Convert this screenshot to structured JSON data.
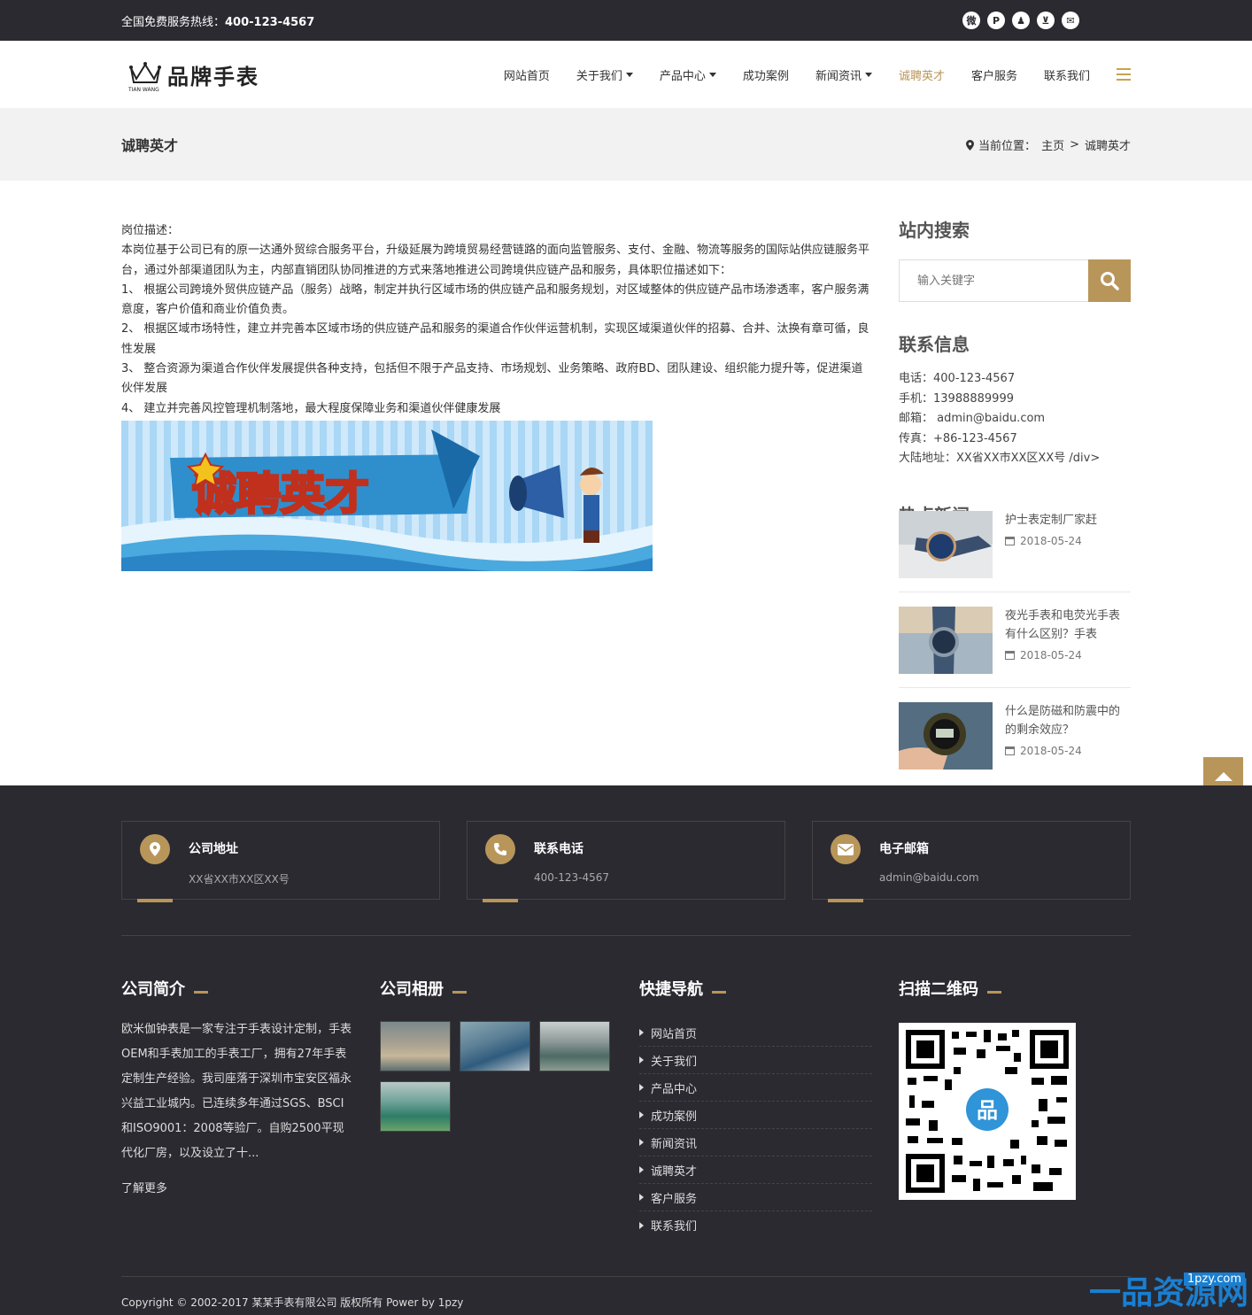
{
  "topbar": {
    "hotline_label": "全国免费服务热线：",
    "hotline_number": "400-123-4567",
    "social_icons": [
      "weibo-icon",
      "pinterest-icon",
      "qq-icon",
      "cart-icon",
      "mail-icon"
    ]
  },
  "header": {
    "brand": "品牌手表",
    "brand_sub": "TIAN WANG",
    "nav": [
      {
        "label": "网站首页",
        "dropdown": false,
        "active": false
      },
      {
        "label": "关于我们",
        "dropdown": true,
        "active": false
      },
      {
        "label": "产品中心",
        "dropdown": true,
        "active": false
      },
      {
        "label": "成功案例",
        "dropdown": false,
        "active": false
      },
      {
        "label": "新闻资讯",
        "dropdown": true,
        "active": false
      },
      {
        "label": "诚聘英才",
        "dropdown": false,
        "active": true
      },
      {
        "label": "客户服务",
        "dropdown": false,
        "active": false
      },
      {
        "label": "联系我们",
        "dropdown": false,
        "active": false
      }
    ]
  },
  "pagebar": {
    "title": "诚聘英才",
    "crumb_label": "当前位置：",
    "crumb_home": "主页",
    "crumb_sep": ">",
    "crumb_current": "诚聘英才"
  },
  "content": {
    "lines": [
      "岗位描述：",
      "本岗位基于公司已有的原一达通外贸综合服务平台，升级延展为跨境贸易经营链路的面向监管服务、支付、金融、物流等服务的国际站供应链服务平台，通过外部渠道团队为主，内部直销团队协同推进的方式来落地推进公司跨境供应链产品和服务，具体职位描述如下：",
      "1、 根据公司跨境外贸供应链产品（服务）战略，制定并执行区域市场的供应链产品和服务规划，对区域整体的供应链产品市场渗透率，客户服务满意度，客户价值和商业价值负责。",
      "2、 根据区域市场特性，建立并完善本区域市场的供应链产品和服务的渠道合作伙伴运营机制，实现区域渠道伙伴的招募、合并、汰换有章可循，良性发展",
      "3、 整合资源为渠道合作伙伴发展提供各种支持，包括但不限于产品支持、市场规划、业务策略、政府BD、团队建设、组织能力提升等，促进渠道伙伴发展",
      "4、 建立并完善风控管理机制落地，最大程度保障业务和渠道伙伴健康发展"
    ],
    "banner_text": "诚聘英才"
  },
  "sidebar": {
    "search_title": "站内搜索",
    "search_placeholder": "输入关键字",
    "contact_title": "联系信息",
    "contact": [
      "电话：400-123-4567",
      "手机：13988889999",
      "邮箱： admin@baidu.com",
      "传真：+86-123-4567",
      "大陆地址：XX省XX市XX区XX号 /div>"
    ],
    "news_title": "热点新闻",
    "news": [
      {
        "title": "护士表定制厂家赶",
        "date": "2018-05-24"
      },
      {
        "title": "夜光手表和电荧光手表有什么区别？手表",
        "date": "2018-05-24"
      },
      {
        "title": "什么是防磁和防震中的的剩余效应？",
        "date": "2018-05-24"
      }
    ]
  },
  "footer": {
    "boxes": [
      {
        "title": "公司地址",
        "value": "XX省XX市XX区XX号",
        "icon": "map-pin-icon"
      },
      {
        "title": "联系电话",
        "value": "400-123-4567",
        "icon": "phone-icon"
      },
      {
        "title": "电子邮箱",
        "value": "admin@baidu.com",
        "icon": "envelope-icon"
      }
    ],
    "intro_title": "公司简介",
    "intro_text": "欧米伽钟表是一家专注于手表设计定制，手表OEM和手表加工的手表工厂，拥有27年手表定制生产经验。我司座落于深圳市宝安区福永兴益工业城内。已连续多年通过SGS、BSCI和ISO9001：2008等验厂。自购2500平现代化厂房，以及设立了十...",
    "intro_more": "了解更多",
    "album_title": "公司相册",
    "nav_title": "快捷导航",
    "quick_nav": [
      "网站首页",
      "关于我们",
      "产品中心",
      "成功案例",
      "新闻资讯",
      "诚聘英才",
      "客户服务",
      "联系我们"
    ],
    "qr_title": "扫描二维码",
    "copyright": "Copyright © 2002-2017 某某手表有限公司 版权所有 Power by 1pzy",
    "watermark_big": "一品资源网",
    "watermark_small": "1pzy.com"
  },
  "colors": {
    "accent": "#b8965a",
    "dark": "#2b2a31",
    "pagebar": "#f2f2f2"
  }
}
